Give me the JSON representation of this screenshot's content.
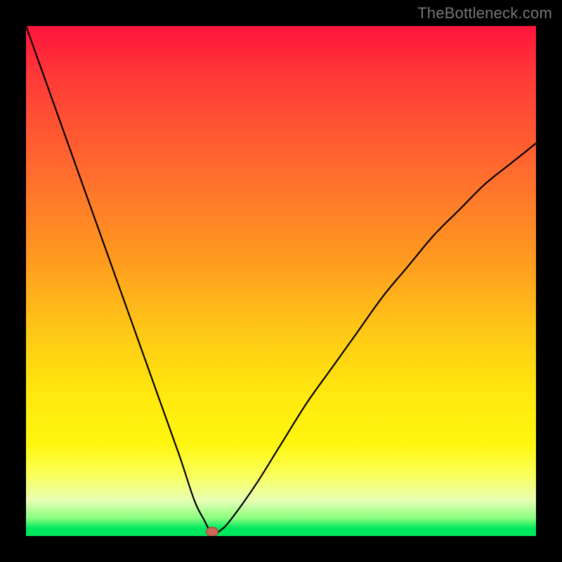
{
  "watermark": "TheBottleneck.com",
  "colors": {
    "background": "#000000",
    "curve_stroke": "#000000",
    "marker_fill": "#cc6655",
    "marker_stroke": "#a04a3c",
    "watermark": "#777777"
  },
  "chart_data": {
    "type": "line",
    "title": "",
    "xlabel": "",
    "ylabel": "",
    "xlim": [
      0,
      100
    ],
    "ylim": [
      0,
      100
    ],
    "grid": false,
    "legend": false,
    "series": [
      {
        "name": "bottleneck-curve",
        "x": [
          0,
          5,
          10,
          15,
          20,
          25,
          30,
          33,
          35,
          36,
          36.5,
          38,
          40,
          45,
          50,
          55,
          60,
          65,
          70,
          75,
          80,
          85,
          90,
          95,
          100
        ],
        "y": [
          100,
          86,
          72,
          58,
          44,
          30,
          16,
          7,
          3,
          1,
          0,
          1,
          3,
          10,
          18,
          26,
          33,
          40,
          47,
          53,
          59,
          64,
          69,
          73,
          77
        ]
      }
    ],
    "marker": {
      "x": 36.5,
      "y": 0
    },
    "gradient_stops": [
      {
        "offset": 0.0,
        "color": "#ff143c"
      },
      {
        "offset": 0.28,
        "color": "#ff6a2e"
      },
      {
        "offset": 0.6,
        "color": "#ffc816"
      },
      {
        "offset": 0.82,
        "color": "#fff60f"
      },
      {
        "offset": 0.93,
        "color": "#e8ffb4"
      },
      {
        "offset": 1.0,
        "color": "#00e85e"
      }
    ]
  }
}
